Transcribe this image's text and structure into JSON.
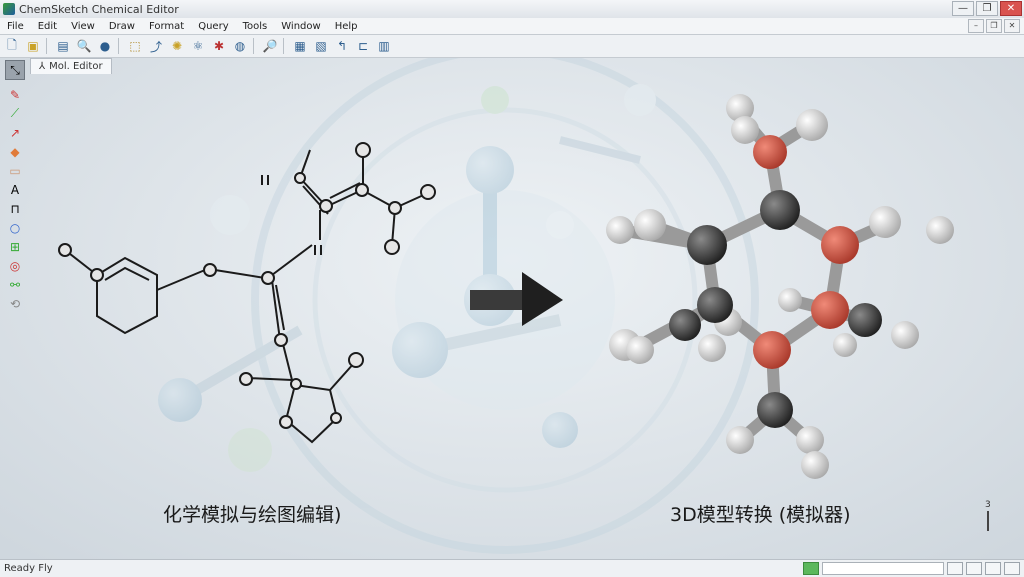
{
  "window": {
    "title": "ChemSketch  Chemical Editor",
    "minimize": "—",
    "maximize": "❐",
    "close": "✕"
  },
  "menu": [
    "File",
    "Edit",
    "View",
    "Draw",
    "Format",
    "Query",
    "Tools",
    "Window",
    "Help"
  ],
  "tab": {
    "label": "Mol. Editor"
  },
  "captions": {
    "left": "化学模拟与绘图编辑)",
    "right": "3D模型转换 (模拟器)"
  },
  "marker": {
    "label": "3"
  },
  "status": {
    "left": "Ready  Fly"
  },
  "colors": {
    "oxygen": "#cc5a4a",
    "carbon": "#3a3a3a",
    "hydrogen": "#e9e9e9",
    "accent": "#2d5e8e"
  },
  "icons": {
    "toolbar": [
      "new-icon",
      "open-icon",
      "save-icon",
      "zoom-icon",
      "sphere-icon",
      "select-icon",
      "rotate-icon",
      "lightbulb-icon",
      "atom-icon",
      "bond-icon",
      "globe-icon",
      "copy-icon",
      "paste-icon",
      "undo-icon",
      "redo-icon",
      "grid-icon"
    ],
    "side": [
      "select-tool-icon",
      "pencil-icon",
      "chain-icon",
      "arrow-tool-icon",
      "eraser-icon",
      "rect-icon",
      "text-icon",
      "bracket-icon",
      "ring-icon",
      "template-icon",
      "lasso-icon",
      "link-icon",
      "clean-icon"
    ]
  }
}
